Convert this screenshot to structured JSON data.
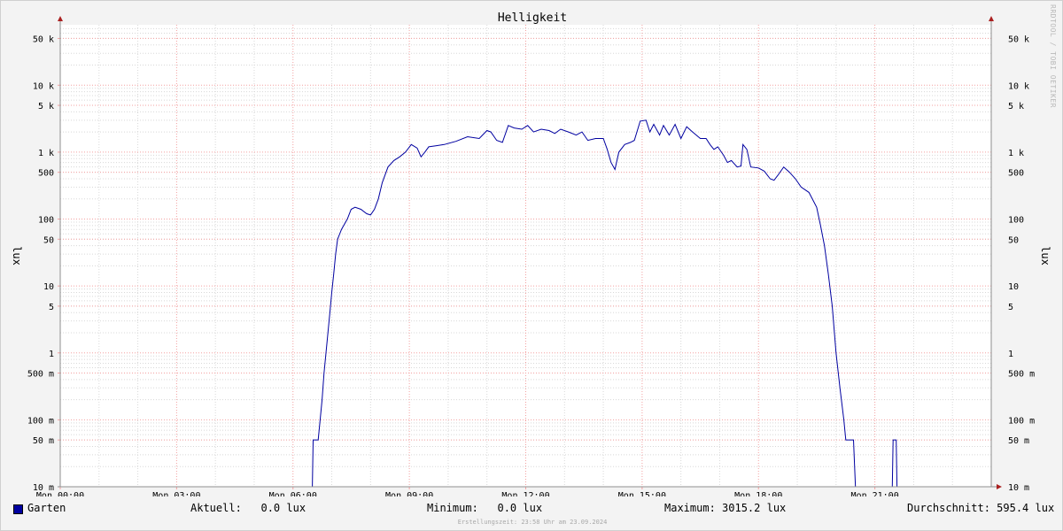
{
  "chart_data": {
    "type": "line",
    "title": "Helligkeit",
    "ylabel": "lux",
    "yscale": "log",
    "ylim": [
      0.01,
      80000
    ],
    "grid": true,
    "x_tick_labels": [
      "Mon 00:00",
      "Mon 03:00",
      "Mon 06:00",
      "Mon 09:00",
      "Mon 12:00",
      "Mon 15:00",
      "Mon 18:00",
      "Mon 21:00"
    ],
    "x_tick_hours": [
      0,
      3,
      6,
      9,
      12,
      15,
      18,
      21
    ],
    "xlim_hours": [
      0,
      24
    ],
    "y_ticks": [
      {
        "label": "50 k",
        "value": 50000
      },
      {
        "label": "10 k",
        "value": 10000
      },
      {
        "label": "5 k",
        "value": 5000
      },
      {
        "label": "1 k",
        "value": 1000
      },
      {
        "label": "500",
        "value": 500
      },
      {
        "label": "100",
        "value": 100
      },
      {
        "label": "50",
        "value": 50
      },
      {
        "label": "10",
        "value": 10
      },
      {
        "label": "5",
        "value": 5
      },
      {
        "label": "1",
        "value": 1
      },
      {
        "label": "500 m",
        "value": 0.5
      },
      {
        "label": "100 m",
        "value": 0.1
      },
      {
        "label": "50 m",
        "value": 0.05
      },
      {
        "label": "10 m",
        "value": 0.01
      }
    ],
    "series": [
      {
        "name": "Garten",
        "color": "#0000a0",
        "points": [
          [
            0.0,
            0.01
          ],
          [
            6.5,
            0.01
          ],
          [
            6.52,
            0.05
          ],
          [
            6.65,
            0.05
          ],
          [
            6.7,
            0.1
          ],
          [
            6.75,
            0.2
          ],
          [
            6.8,
            0.5
          ],
          [
            6.85,
            1
          ],
          [
            6.9,
            2
          ],
          [
            6.95,
            4
          ],
          [
            7.0,
            8
          ],
          [
            7.05,
            15
          ],
          [
            7.1,
            30
          ],
          [
            7.15,
            50
          ],
          [
            7.25,
            70
          ],
          [
            7.4,
            100
          ],
          [
            7.5,
            140
          ],
          [
            7.6,
            150
          ],
          [
            7.75,
            140
          ],
          [
            7.9,
            120
          ],
          [
            8.0,
            115
          ],
          [
            8.1,
            140
          ],
          [
            8.2,
            200
          ],
          [
            8.3,
            350
          ],
          [
            8.45,
            600
          ],
          [
            8.6,
            750
          ],
          [
            8.75,
            850
          ],
          [
            8.9,
            1000
          ],
          [
            9.05,
            1300
          ],
          [
            9.2,
            1150
          ],
          [
            9.3,
            850
          ],
          [
            9.4,
            1000
          ],
          [
            9.5,
            1200
          ],
          [
            9.7,
            1250
          ],
          [
            9.9,
            1300
          ],
          [
            10.2,
            1450
          ],
          [
            10.5,
            1700
          ],
          [
            10.8,
            1600
          ],
          [
            11.0,
            2100
          ],
          [
            11.1,
            2000
          ],
          [
            11.25,
            1500
          ],
          [
            11.4,
            1400
          ],
          [
            11.55,
            2500
          ],
          [
            11.7,
            2300
          ],
          [
            11.9,
            2200
          ],
          [
            12.05,
            2500
          ],
          [
            12.2,
            2000
          ],
          [
            12.4,
            2200
          ],
          [
            12.6,
            2100
          ],
          [
            12.75,
            1900
          ],
          [
            12.9,
            2200
          ],
          [
            13.1,
            2000
          ],
          [
            13.3,
            1800
          ],
          [
            13.45,
            2000
          ],
          [
            13.6,
            1500
          ],
          [
            13.8,
            1600
          ],
          [
            14.0,
            1600
          ],
          [
            14.1,
            1100
          ],
          [
            14.2,
            700
          ],
          [
            14.3,
            550
          ],
          [
            14.4,
            1000
          ],
          [
            14.55,
            1300
          ],
          [
            14.7,
            1400
          ],
          [
            14.8,
            1500
          ],
          [
            14.95,
            2900
          ],
          [
            15.1,
            3000
          ],
          [
            15.2,
            2000
          ],
          [
            15.3,
            2600
          ],
          [
            15.45,
            1800
          ],
          [
            15.55,
            2500
          ],
          [
            15.7,
            1800
          ],
          [
            15.85,
            2600
          ],
          [
            16.0,
            1600
          ],
          [
            16.15,
            2400
          ],
          [
            16.3,
            2000
          ],
          [
            16.5,
            1600
          ],
          [
            16.65,
            1600
          ],
          [
            16.75,
            1300
          ],
          [
            16.85,
            1100
          ],
          [
            16.95,
            1200
          ],
          [
            17.1,
            900
          ],
          [
            17.2,
            700
          ],
          [
            17.3,
            750
          ],
          [
            17.45,
            600
          ],
          [
            17.55,
            620
          ],
          [
            17.6,
            1300
          ],
          [
            17.7,
            1100
          ],
          [
            17.8,
            600
          ],
          [
            18.0,
            580
          ],
          [
            18.15,
            520
          ],
          [
            18.3,
            400
          ],
          [
            18.4,
            380
          ],
          [
            18.5,
            450
          ],
          [
            18.65,
            600
          ],
          [
            18.8,
            500
          ],
          [
            18.95,
            400
          ],
          [
            19.1,
            300
          ],
          [
            19.3,
            250
          ],
          [
            19.5,
            150
          ],
          [
            19.6,
            80
          ],
          [
            19.7,
            40
          ],
          [
            19.8,
            15
          ],
          [
            19.9,
            5
          ],
          [
            20.0,
            1
          ],
          [
            20.1,
            0.3
          ],
          [
            20.2,
            0.1
          ],
          [
            20.25,
            0.05
          ],
          [
            20.45,
            0.05
          ],
          [
            20.5,
            0.01
          ],
          [
            21.45,
            0.01
          ],
          [
            21.47,
            0.05
          ],
          [
            21.55,
            0.05
          ],
          [
            21.57,
            0.01
          ],
          [
            24.0,
            0.01
          ]
        ]
      }
    ]
  },
  "side_mark": "RRDTOOL / TOBI OETIKER",
  "legend": {
    "series_name": "Garten",
    "current": "Aktuell:   0.0 lux",
    "minimum": "Minimum:   0.0 lux",
    "maximum": "Maximum: 3015.2 lux",
    "average": "Durchschnitt: 595.4 lux"
  },
  "footer": "Erstellungszeit: 23:58 Uhr am 23.09.2024",
  "colors": {
    "line": "#0000a0",
    "major_grid": "#f3a0a0",
    "minor_grid": "#d8d8d8",
    "axis": "#8f8f8f",
    "arrow": "#aa2020"
  }
}
